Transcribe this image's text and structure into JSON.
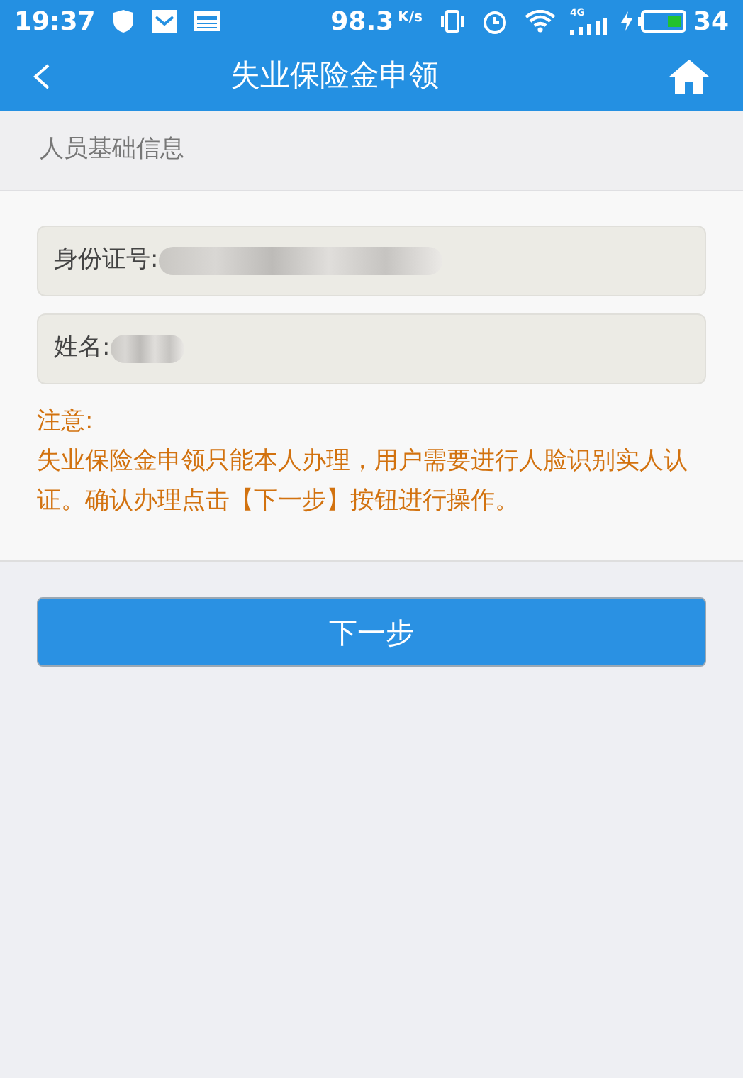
{
  "status_bar": {
    "time": "19:37",
    "speed": "98.3",
    "speed_unit": "K/s",
    "network": "4G",
    "battery": "34"
  },
  "nav_bar": {
    "title": "失业保险金申领"
  },
  "section": {
    "title": "人员基础信息"
  },
  "fields": [
    {
      "label": "身份证号:"
    },
    {
      "label": "姓名:"
    }
  ],
  "notice": {
    "title": "注意:",
    "text": "失业保险金申领只能本人办理，用户需要进行人脸识别实人认证。确认办理点击【下一步】按钮进行操作。"
  },
  "button": {
    "label": "下一步"
  }
}
